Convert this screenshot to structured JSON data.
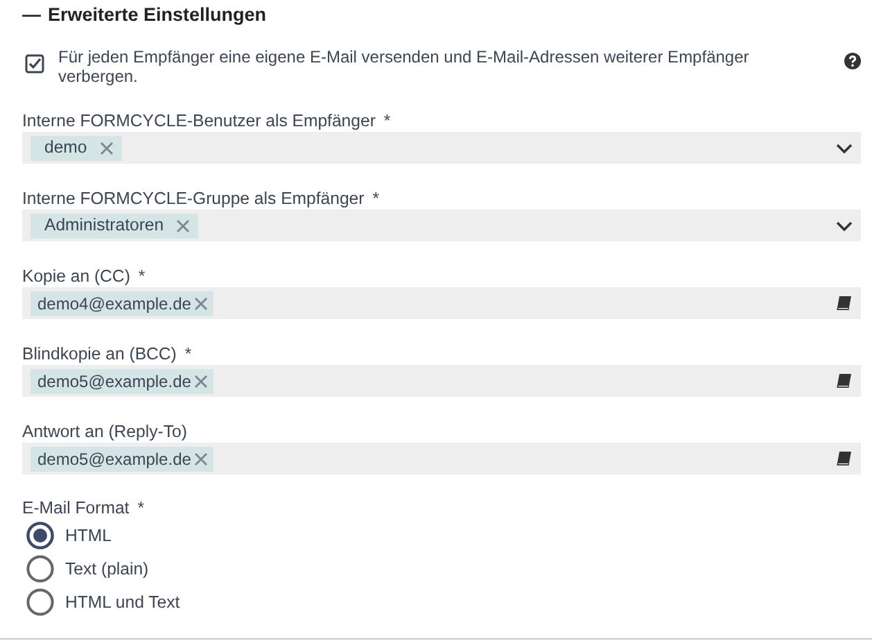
{
  "section": {
    "toggle": "—",
    "title": "Erweiterte Einstellungen"
  },
  "option": {
    "label": "Für jeden Empfänger eine eigene E-Mail versenden und E-Mail-Adressen weiterer Empfänger verbergen.",
    "checked": true
  },
  "fields": [
    {
      "label": "Interne FORMCYCLE-Benutzer als Empfänger",
      "required_mark": "*",
      "kind": "select",
      "tags": [
        "demo"
      ]
    },
    {
      "label": "Interne FORMCYCLE-Gruppe als Empfänger",
      "required_mark": "*",
      "kind": "select",
      "tags": [
        "Administratoren"
      ]
    },
    {
      "label": "Kopie an (CC)",
      "required_mark": "*",
      "kind": "address",
      "tags": [
        "demo4@example.de"
      ]
    },
    {
      "label": "Blindkopie an (BCC)",
      "required_mark": "*",
      "kind": "address",
      "tags": [
        "demo5@example.de"
      ]
    },
    {
      "label": "Antwort an (Reply-To)",
      "kind": "address",
      "tags": [
        "demo5@example.de"
      ]
    }
  ],
  "format": {
    "label": "E-Mail Format",
    "required_mark": "*",
    "options": [
      {
        "label": "HTML",
        "selected": true
      },
      {
        "label": "Text (plain)",
        "selected": false
      },
      {
        "label": "HTML und Text",
        "selected": false
      }
    ]
  }
}
